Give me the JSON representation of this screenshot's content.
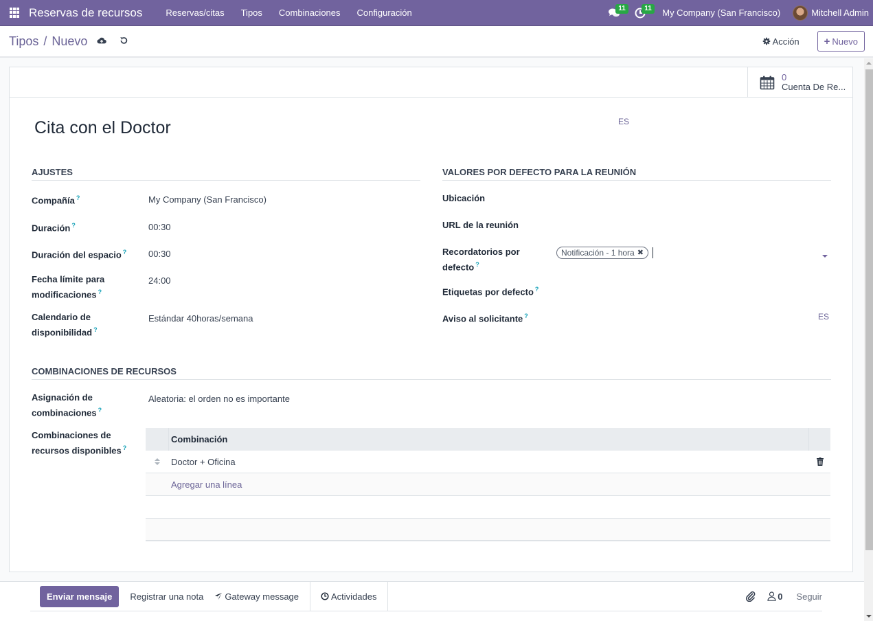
{
  "navbar": {
    "app_name": "Reservas de recursos",
    "menu": [
      "Reservas/citas",
      "Tipos",
      "Combinaciones",
      "Configuración"
    ],
    "messages_badge": "11",
    "activities_badge": "11",
    "company": "My Company (San Francisco)",
    "user": "Mitchell Admin"
  },
  "control_panel": {
    "breadcrumb_parent": "Tipos",
    "breadcrumb_separator": "/",
    "breadcrumb_current": "Nuevo",
    "action_label": "Acción",
    "new_label": "Nuevo"
  },
  "stat_button": {
    "value": "0",
    "label": "Cuenta De Re..."
  },
  "form": {
    "name": "Cita con el Doctor",
    "name_lang": "ES",
    "sections": {
      "settings": "AJUSTES",
      "meeting_defaults": "VALORES POR DEFECTO PARA LA REUNIÓN",
      "combinations": "COMBINACIONES DE RECURSOS"
    },
    "settings_fields": {
      "company_label": "Compañía",
      "company_value": "My Company (San Francisco)",
      "duration_label": "Duración",
      "duration_value": "00:30",
      "slot_duration_label": "Duración del espacio",
      "slot_duration_value": "00:30",
      "deadline_label_1": "Fecha límite para",
      "deadline_label_2": "modificaciones",
      "deadline_value": "24:00",
      "calendar_label_1": "Calendario de",
      "calendar_label_2": "disponibilidad",
      "calendar_value": "Estándar 40horas/semana"
    },
    "meeting_fields": {
      "location_label": "Ubicación",
      "url_label": "URL de la reunión",
      "reminders_label_1": "Recordatorios por",
      "reminders_label_2": "defecto",
      "reminder_tag": "Notificación - 1 hora",
      "tags_label": "Etiquetas por defecto",
      "notice_label": "Aviso al solicitante",
      "notice_lang": "ES"
    },
    "combination_fields": {
      "assignment_label_1": "Asignación de",
      "assignment_label_2": "combinaciones",
      "assignment_value": "Aleatoria: el orden no es importante",
      "available_label_1": "Combinaciones de",
      "available_label_2": "recursos disponibles"
    },
    "help_mark": "?",
    "table": {
      "column": "Combinación",
      "rows": [
        "Doctor + Oficina"
      ],
      "add_line": "Agregar una línea"
    }
  },
  "chatter": {
    "send_message": "Enviar mensaje",
    "log_note": "Registrar una nota",
    "gateway_message": "Gateway message",
    "activities": "Actividades",
    "followers_count": "0",
    "follow": "Seguir"
  },
  "colors": {
    "brand": "#71639e",
    "badge": "#28a745",
    "help": "#17a2b8"
  }
}
